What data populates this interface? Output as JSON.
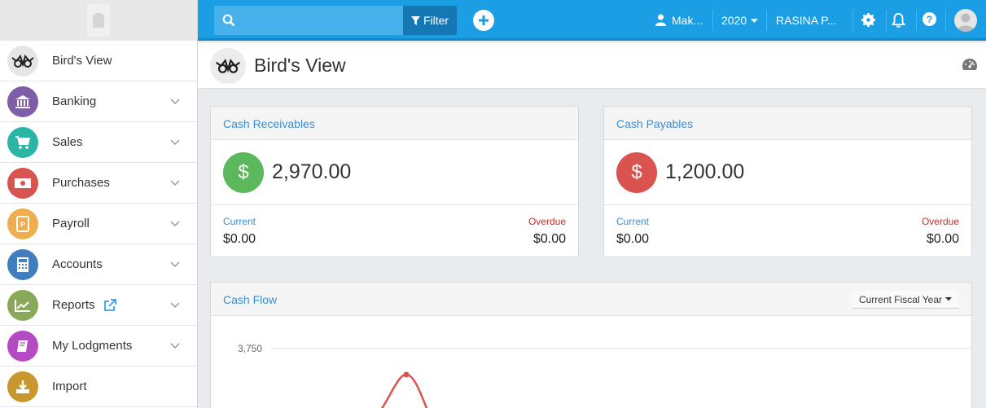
{
  "sidebar": {
    "items": [
      {
        "label": "Bird's View",
        "color": "#e0e0e0",
        "icon": "owl-logo-icon"
      },
      {
        "label": "Banking",
        "color": "#7e5ea8",
        "icon": "bank-icon"
      },
      {
        "label": "Sales",
        "color": "#2bb5a4",
        "icon": "cart-icon"
      },
      {
        "label": "Purchases",
        "color": "#d9534f",
        "icon": "money-icon"
      },
      {
        "label": "Payroll",
        "color": "#f0ad4e",
        "icon": "payroll-icon"
      },
      {
        "label": "Accounts",
        "color": "#3f7fbf",
        "icon": "calculator-icon"
      },
      {
        "label": "Reports",
        "color": "#8aa85a",
        "icon": "chart-icon"
      },
      {
        "label": "My Lodgments",
        "color": "#b64ac4",
        "icon": "book-icon"
      },
      {
        "label": "Import",
        "color": "#c9962f",
        "icon": "download-icon"
      }
    ]
  },
  "topbar": {
    "filter_label": "Filter",
    "user_name": "Mak...",
    "year": "2020",
    "company": "RASINA P..."
  },
  "page": {
    "title": "Bird's View"
  },
  "receivables": {
    "title": "Cash Receivables",
    "amount": "2,970.00",
    "current_label": "Current",
    "current_value": "$0.00",
    "overdue_label": "Overdue",
    "overdue_value": "$0.00",
    "dollar": "$",
    "color": "#5cb85c"
  },
  "payables": {
    "title": "Cash Payables",
    "amount": "1,200.00",
    "current_label": "Current",
    "current_value": "$0.00",
    "overdue_label": "Overdue",
    "overdue_value": "$0.00",
    "dollar": "$",
    "color": "#d9534f"
  },
  "cashflow": {
    "title": "Cash Flow",
    "period_label": "Current Fiscal Year",
    "chart_data": {
      "type": "line",
      "y_tick_labels": [
        "3,750"
      ],
      "line_color": "#d9534f"
    }
  }
}
